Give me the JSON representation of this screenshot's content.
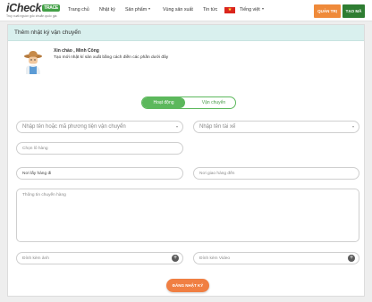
{
  "logo": {
    "name": "iCheck",
    "badge": "TRACE",
    "tagline": "Truy xuất nguồn gốc chuẩn quốc gia"
  },
  "nav": {
    "items": [
      "Trang chủ",
      "Nhật ký",
      "Sản phẩm",
      "Vùng sản xuất",
      "Tin tức"
    ],
    "language": "Tiếng việt",
    "flag_star": "★",
    "admin_button": "QUẢN TRỊ",
    "create_button": "TẠO MÃ"
  },
  "page": {
    "title": "Thêm nhật ký vận chuyển",
    "greeting": "Xin chào , Minh Công",
    "greeting_sub": "Tạo mới nhật kí sản xuất bằng cách điền các phần dưới đây"
  },
  "toggle": {
    "active": "Hoạt động",
    "inactive": "Vận chuyển"
  },
  "form": {
    "vehicle_placeholder": "Nhập tên hoặc mã phương tiện vận chuyển",
    "driver_placeholder": "Nhập tên tài xế",
    "shipment_placeholder": "Chọn lô hàng",
    "pickup_value": "Nơi lấy hàng đi",
    "delivery_placeholder": "Nơi giao hàng đến",
    "info_placeholder": "Thông tin chuyến hàng",
    "attach_image_placeholder": "Đính kèm ảnh",
    "attach_video_placeholder": "Đính kèm Video",
    "submit_label": "ĐĂNG NHẬT KÝ"
  },
  "colors": {
    "primary_green": "#5cb85c",
    "orange": "#f07f43",
    "dark_green": "#2e7d32",
    "header_bg": "#d9f0ee"
  }
}
